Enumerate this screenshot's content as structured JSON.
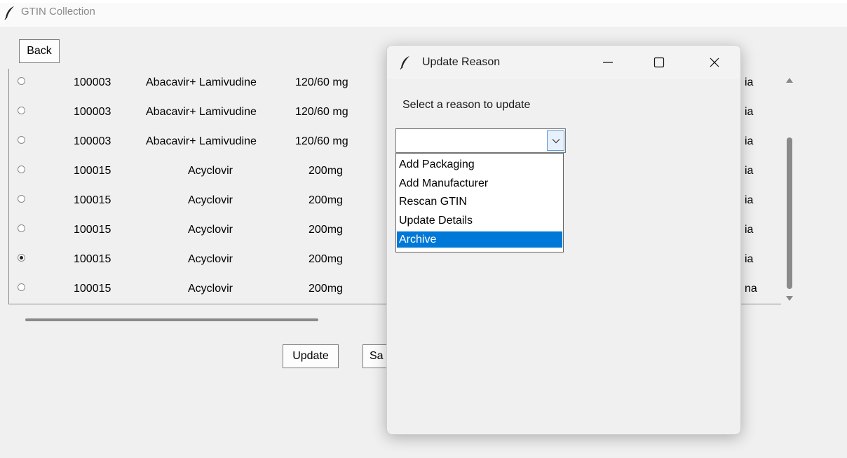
{
  "main_window": {
    "title": "GTIN Collection",
    "back_label": "Back",
    "rows": [
      {
        "selected": false,
        "code": "100003",
        "name": "Abacavir+ Lamivudine",
        "dose": "120/60 mg",
        "tail": "ia"
      },
      {
        "selected": false,
        "code": "100003",
        "name": "Abacavir+ Lamivudine",
        "dose": "120/60 mg",
        "tail": "ia"
      },
      {
        "selected": false,
        "code": "100003",
        "name": "Abacavir+ Lamivudine",
        "dose": "120/60 mg",
        "tail": "ia"
      },
      {
        "selected": false,
        "code": "100015",
        "name": "Acyclovir",
        "dose": "200mg",
        "tail": "ia"
      },
      {
        "selected": false,
        "code": "100015",
        "name": "Acyclovir",
        "dose": "200mg",
        "tail": "ia"
      },
      {
        "selected": false,
        "code": "100015",
        "name": "Acyclovir",
        "dose": "200mg",
        "tail": "ia"
      },
      {
        "selected": true,
        "code": "100015",
        "name": "Acyclovir",
        "dose": "200mg",
        "tail": "ia"
      },
      {
        "selected": false,
        "code": "100015",
        "name": "Acyclovir",
        "dose": "200mg",
        "tail": "na"
      }
    ],
    "update_label": "Update",
    "save_label_visible": "Sa"
  },
  "dialog": {
    "title": "Update Reason",
    "prompt": "Select a reason to update",
    "combo_value": "",
    "options": [
      {
        "label": "Add Packaging",
        "highlighted": false
      },
      {
        "label": "Add Manufacturer",
        "highlighted": false
      },
      {
        "label": "Rescan GTIN",
        "highlighted": false
      },
      {
        "label": "Update Details",
        "highlighted": false
      },
      {
        "label": "Archive",
        "highlighted": true
      }
    ]
  },
  "icons": {
    "app": "feather-icon",
    "minimize": "minimize-icon",
    "maximize": "maximize-icon",
    "close": "close-icon",
    "dropdown": "chevron-down-icon"
  },
  "colors": {
    "selection": "#0078d7",
    "window_bg": "#f0f0f0"
  }
}
